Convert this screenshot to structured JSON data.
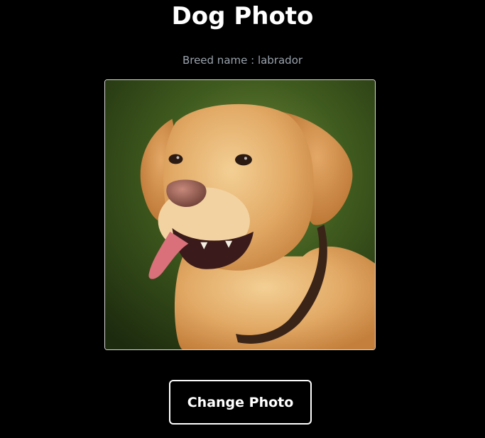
{
  "header": {
    "title": "Dog Photo"
  },
  "breed": {
    "text": "Breed name : labrador"
  },
  "photo": {
    "subject": "labrador dog photo"
  },
  "actions": {
    "change_photo_label": "Change Photo"
  },
  "colors": {
    "background": "#000000",
    "text": "#ffffff",
    "muted_text": "#9aa3ad",
    "button_border": "#ffffff"
  }
}
